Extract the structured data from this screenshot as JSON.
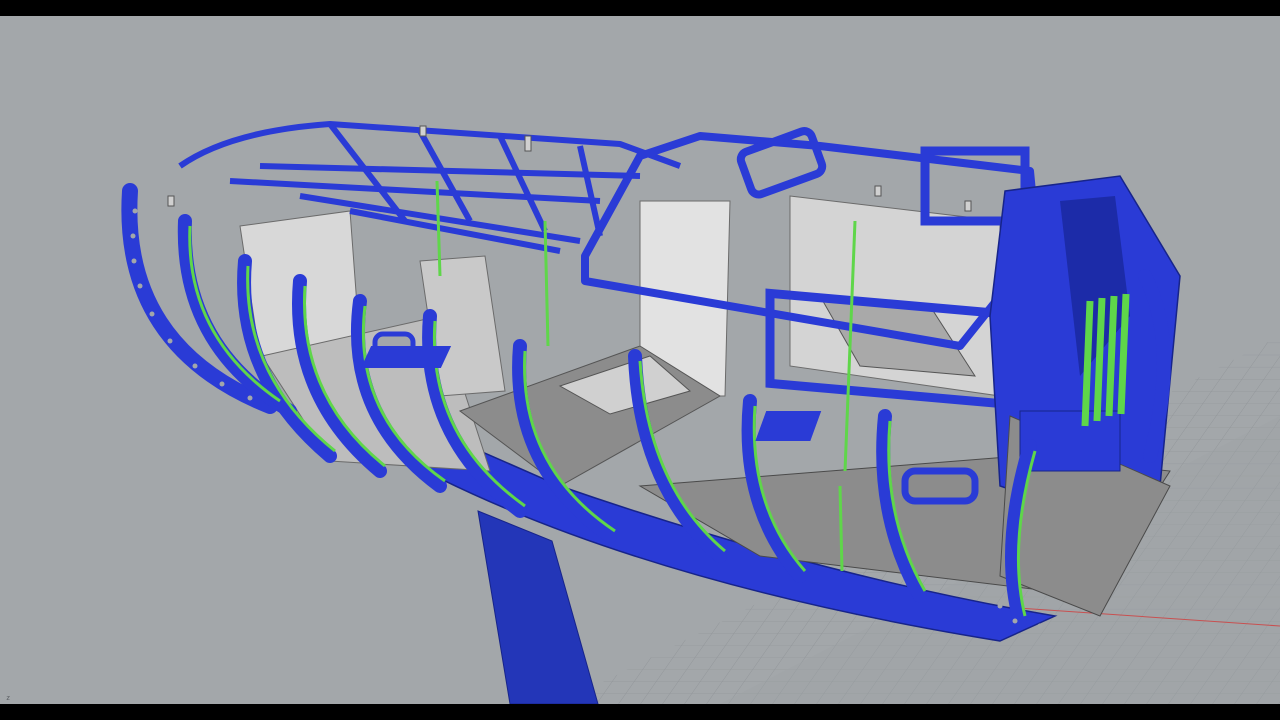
{
  "app": {
    "view_mode": "Shaded"
  },
  "viewport": {
    "background_color": "#a3a7aa",
    "grid_color": "#9ea2a6",
    "grid_line_color": "#8e9296",
    "axis_x_color": "#c85050",
    "axis_label": "z"
  },
  "model": {
    "frame_color": "#2a3bd6",
    "frame_dark_color": "#1c2ba8",
    "stringer_color": "#5fd64a",
    "panel_light_color": "#d8d8d8",
    "panel_mid_color": "#bdbdbd",
    "panel_dark_color": "#8c8c8c",
    "keel_color": "#2336b8"
  }
}
